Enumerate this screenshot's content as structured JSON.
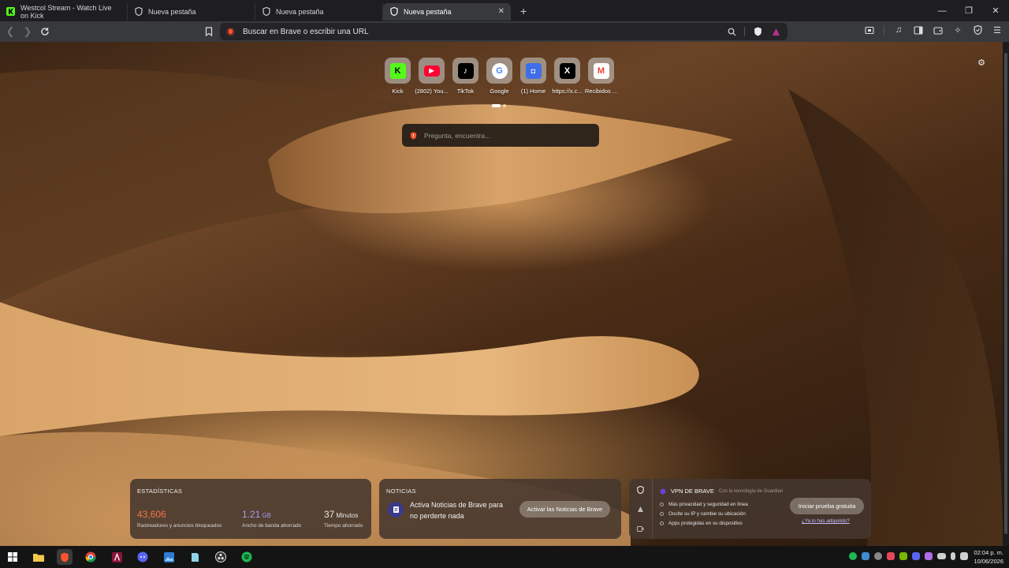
{
  "tabs": [
    {
      "title": "Westcol Stream - Watch Live on Kick",
      "favicon": "kick-icon",
      "active": false
    },
    {
      "title": "Nueva pestaña",
      "favicon": "brave-shield-icon",
      "active": false
    },
    {
      "title": "Nueva pestaña",
      "favicon": "brave-shield-icon",
      "active": false
    },
    {
      "title": "Nueva pestaña",
      "favicon": "brave-shield-icon",
      "active": true
    }
  ],
  "toolbar": {
    "address_placeholder": "Buscar en Brave o escribir una URL"
  },
  "top_sites": [
    {
      "label": "Kick",
      "icon": "kick-icon",
      "color": "#53fc18"
    },
    {
      "label": "(2802) You...",
      "icon": "youtube-icon",
      "color": "#ff0033"
    },
    {
      "label": "TikTok",
      "icon": "tiktok-icon",
      "color": "#000000"
    },
    {
      "label": "Google",
      "icon": "google-icon",
      "color": "#4285f4"
    },
    {
      "label": "(1) Home",
      "icon": "home-icon",
      "color": "#3f6ee8"
    },
    {
      "label": "https://x.c...",
      "icon": "x-icon",
      "color": "#000000"
    },
    {
      "label": "Recibidos ...",
      "icon": "gmail-icon",
      "color": "#ea4335"
    }
  ],
  "search": {
    "placeholder": "Pregunta, encuentra..."
  },
  "stats": {
    "title": "ESTADÍSTICAS",
    "trackers_value": "43,606",
    "trackers_label": "Rastreadores y anuncios bloqueados",
    "bandwidth_value": "1.21",
    "bandwidth_unit": "GB",
    "bandwidth_label": "Ancho de banda ahorrado",
    "time_value": "37",
    "time_unit": "Minutos",
    "time_label": "Tiempo ahorrado",
    "colors": {
      "trackers": "#f0764a",
      "bandwidth": "#a99cf2",
      "time": "#ffffff"
    }
  },
  "news": {
    "title": "NOTICIAS",
    "text": "Activa Noticias de Brave para no perderte nada",
    "button": "Activar las Noticias de Brave"
  },
  "vpn": {
    "title": "VPN DE BRAVE",
    "powered_by": "Con la tecnología de Guardian",
    "features": [
      "Más privacidad y seguridad en línea",
      "Oculte su IP y cambie su ubicación",
      "Apps protegidas en su dispositivo"
    ],
    "button": "Iniciar prueba gratuita",
    "link": "¿Ya lo has adquirido?"
  },
  "taskbar": {
    "time": "02:04 p. m.",
    "date": "10/06/2026"
  }
}
